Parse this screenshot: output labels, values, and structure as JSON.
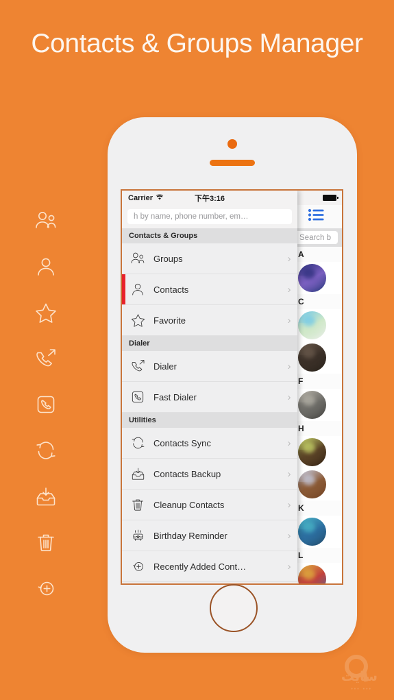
{
  "page": {
    "headline": "Contacts & Groups Manager",
    "background_color": "#ee8432",
    "accent_color": "#ee8432",
    "selection_color": "#e8222a"
  },
  "left_rail": {
    "icons": [
      {
        "name": "groups-icon"
      },
      {
        "name": "person-icon"
      },
      {
        "name": "star-icon"
      },
      {
        "name": "outgoing-call-icon"
      },
      {
        "name": "phone-square-icon"
      },
      {
        "name": "sync-icon"
      },
      {
        "name": "backup-inbox-icon"
      },
      {
        "name": "trash-icon"
      },
      {
        "name": "add-circle-icon"
      }
    ]
  },
  "phone": {
    "home_button": "home-button",
    "camera": "front-camera",
    "speaker": "earpiece-speaker"
  },
  "screen": {
    "status_bar": {
      "carrier": "Carrier",
      "wifi_icon": "wifi-icon",
      "time": "下午3:16",
      "battery_icon": "battery-icon"
    },
    "menu_pane": {
      "search": {
        "placeholder": "h by name, phone number, em…",
        "value": ""
      },
      "sections": [
        {
          "header": "Contacts & Groups",
          "items": [
            {
              "label": "Groups",
              "icon": "groups-icon",
              "selected": false
            },
            {
              "label": "Contacts",
              "icon": "person-icon",
              "selected": true
            },
            {
              "label": "Favorite",
              "icon": "star-icon",
              "selected": false
            }
          ]
        },
        {
          "header": "Dialer",
          "items": [
            {
              "label": "Dialer",
              "icon": "outgoing-call-icon",
              "selected": false
            },
            {
              "label": "Fast Dialer",
              "icon": "phone-square-icon",
              "selected": false
            }
          ]
        },
        {
          "header": "Utilities",
          "items": [
            {
              "label": "Contacts Sync",
              "icon": "sync-icon",
              "selected": false
            },
            {
              "label": "Contacts Backup",
              "icon": "backup-inbox-icon",
              "selected": false
            },
            {
              "label": "Cleanup Contacts",
              "icon": "trash-icon",
              "selected": false
            },
            {
              "label": "Birthday Reminder",
              "icon": "birthday-cake-icon",
              "selected": false
            },
            {
              "label": "Recently Added Cont…",
              "icon": "add-circle-icon",
              "selected": false
            }
          ]
        }
      ],
      "chevron": "›"
    },
    "contacts_pane": {
      "list_icon": "list-icon",
      "search": {
        "placeholder": "Search b",
        "value": ""
      },
      "groups": [
        {
          "letter": "A",
          "contacts": [
            {
              "avatar": "avatar-a1",
              "colors": [
                "#2b2f7a",
                "#7a5fc0",
                "#14306b"
              ]
            }
          ]
        },
        {
          "letter": "C",
          "contacts": [
            {
              "avatar": "avatar-c1",
              "colors": [
                "#6fc7e8",
                "#cfe8c8",
                "#efefef"
              ]
            },
            {
              "avatar": "avatar-c2",
              "colors": [
                "#6a5a4c",
                "#3b3028",
                "#262018"
              ]
            }
          ]
        },
        {
          "letter": "F",
          "contacts": [
            {
              "avatar": "avatar-f1",
              "colors": [
                "#b6b2a8",
                "#6e6d68",
                "#3c3b38"
              ]
            }
          ]
        },
        {
          "letter": "H",
          "contacts": [
            {
              "avatar": "avatar-h1",
              "colors": [
                "#c9d86a",
                "#5a4226",
                "#2b1c10"
              ]
            },
            {
              "avatar": "avatar-h2",
              "colors": [
                "#c8cfe6",
                "#8b5a36",
                "#6d3f20"
              ]
            }
          ]
        },
        {
          "letter": "K",
          "contacts": [
            {
              "avatar": "avatar-k1",
              "colors": [
                "#4ab7c8",
                "#2c6ea0",
                "#20445f"
              ]
            }
          ]
        },
        {
          "letter": "L",
          "contacts": [
            {
              "avatar": "avatar-l1",
              "colors": [
                "#e0b23c",
                "#c2413c",
                "#3d6fa8"
              ]
            }
          ]
        }
      ]
    }
  },
  "watermark": {
    "text": "سایت",
    "sub": "••• •••"
  }
}
